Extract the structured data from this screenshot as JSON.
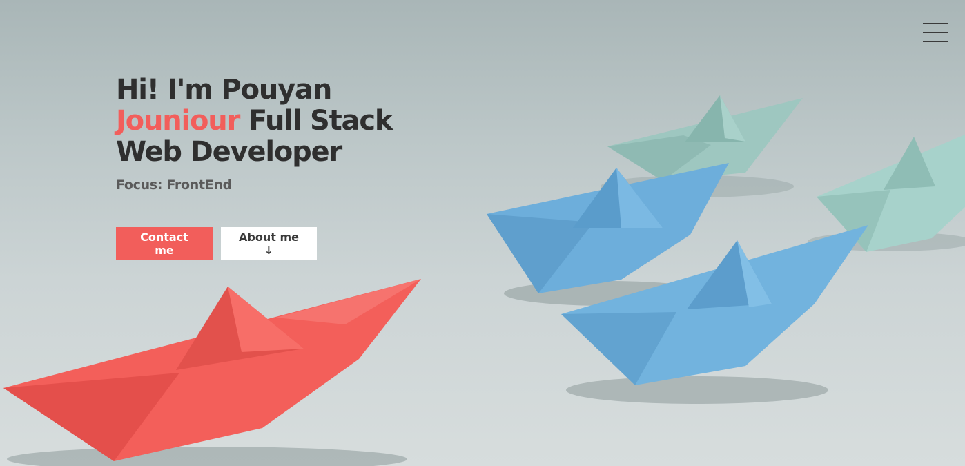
{
  "hero": {
    "line1": "Hi! I'm Pouyan",
    "accent_word": "Jouniour",
    "line2_rest": " Full Stack",
    "line3": "Web Developer",
    "focus": "Focus: FrontEnd",
    "contact_label": "Contact me",
    "about_label": "About me ↓"
  },
  "icons": {
    "menu": "hamburger-menu-icon"
  },
  "colors": {
    "accent": "#f25e5b",
    "heading": "#2f2f2f",
    "subheading": "#5a5a5a",
    "background": "#c5cfd0"
  }
}
